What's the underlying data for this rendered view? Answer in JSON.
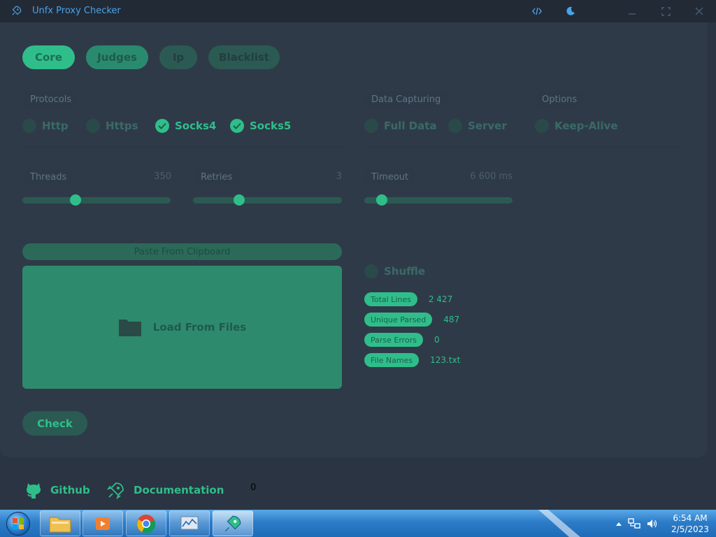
{
  "window": {
    "title": "Unfx Proxy Checker"
  },
  "tabs": [
    {
      "label": "Core"
    },
    {
      "label": "Judges"
    },
    {
      "label": "Ip"
    },
    {
      "label": "Blacklist"
    }
  ],
  "protocols": {
    "label": "Protocols",
    "items": [
      {
        "label": "Http",
        "checked": false
      },
      {
        "label": "Https",
        "checked": false
      },
      {
        "label": "Socks4",
        "checked": true
      },
      {
        "label": "Socks5",
        "checked": true
      }
    ]
  },
  "data_capturing": {
    "label": "Data Capturing",
    "items": [
      {
        "label": "Full Data",
        "checked": false
      },
      {
        "label": "Server",
        "checked": false
      }
    ]
  },
  "options": {
    "label": "Options",
    "items": [
      {
        "label": "Keep-Alive",
        "checked": false
      }
    ]
  },
  "sliders": {
    "threads": {
      "label": "Threads",
      "value": "350",
      "fraction": 0.36
    },
    "retries": {
      "label": "Retries",
      "value": "3",
      "fraction": 0.31
    },
    "timeout": {
      "label": "Timeout",
      "value": "6 600 ms",
      "fraction": 0.12
    }
  },
  "input": {
    "paste_label": "Paste From Clipboard",
    "load_label": "Load From Files"
  },
  "shuffle": {
    "label": "Shuffle",
    "checked": false
  },
  "stats": [
    {
      "label": "Total Lines",
      "value": "2 427"
    },
    {
      "label": "Unique Parsed",
      "value": "487"
    },
    {
      "label": "Parse Errors",
      "value": "0"
    },
    {
      "label": "File Names",
      "value": "123.txt"
    }
  ],
  "check_label": "Check",
  "footer": {
    "github_label": "Github",
    "docs_label": "Documentation",
    "stray_text": "0"
  },
  "taskbar": {
    "time": "6:54 AM",
    "date": "2/5/2023"
  },
  "colors": {
    "accent": "#2fbe8a",
    "background": "#2f3a48",
    "titlebar": "#222a36"
  }
}
